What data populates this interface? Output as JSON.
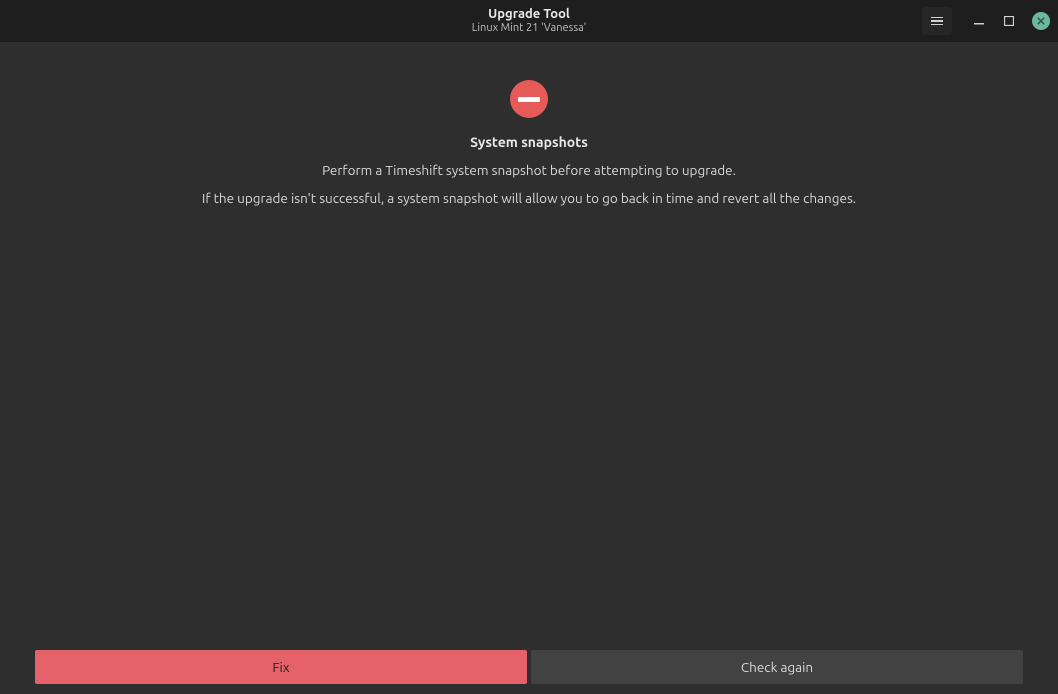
{
  "titlebar": {
    "title": "Upgrade Tool",
    "subtitle": "Linux Mint 21 'Vanessa'"
  },
  "content": {
    "section_title": "System snapshots",
    "line1": "Perform a Timeshift system snapshot before attempting to upgrade.",
    "line2": "If the upgrade isn't successful, a system snapshot will allow you to go back in time and revert all the changes."
  },
  "footer": {
    "fix_label": "Fix",
    "check_again_label": "Check again"
  }
}
